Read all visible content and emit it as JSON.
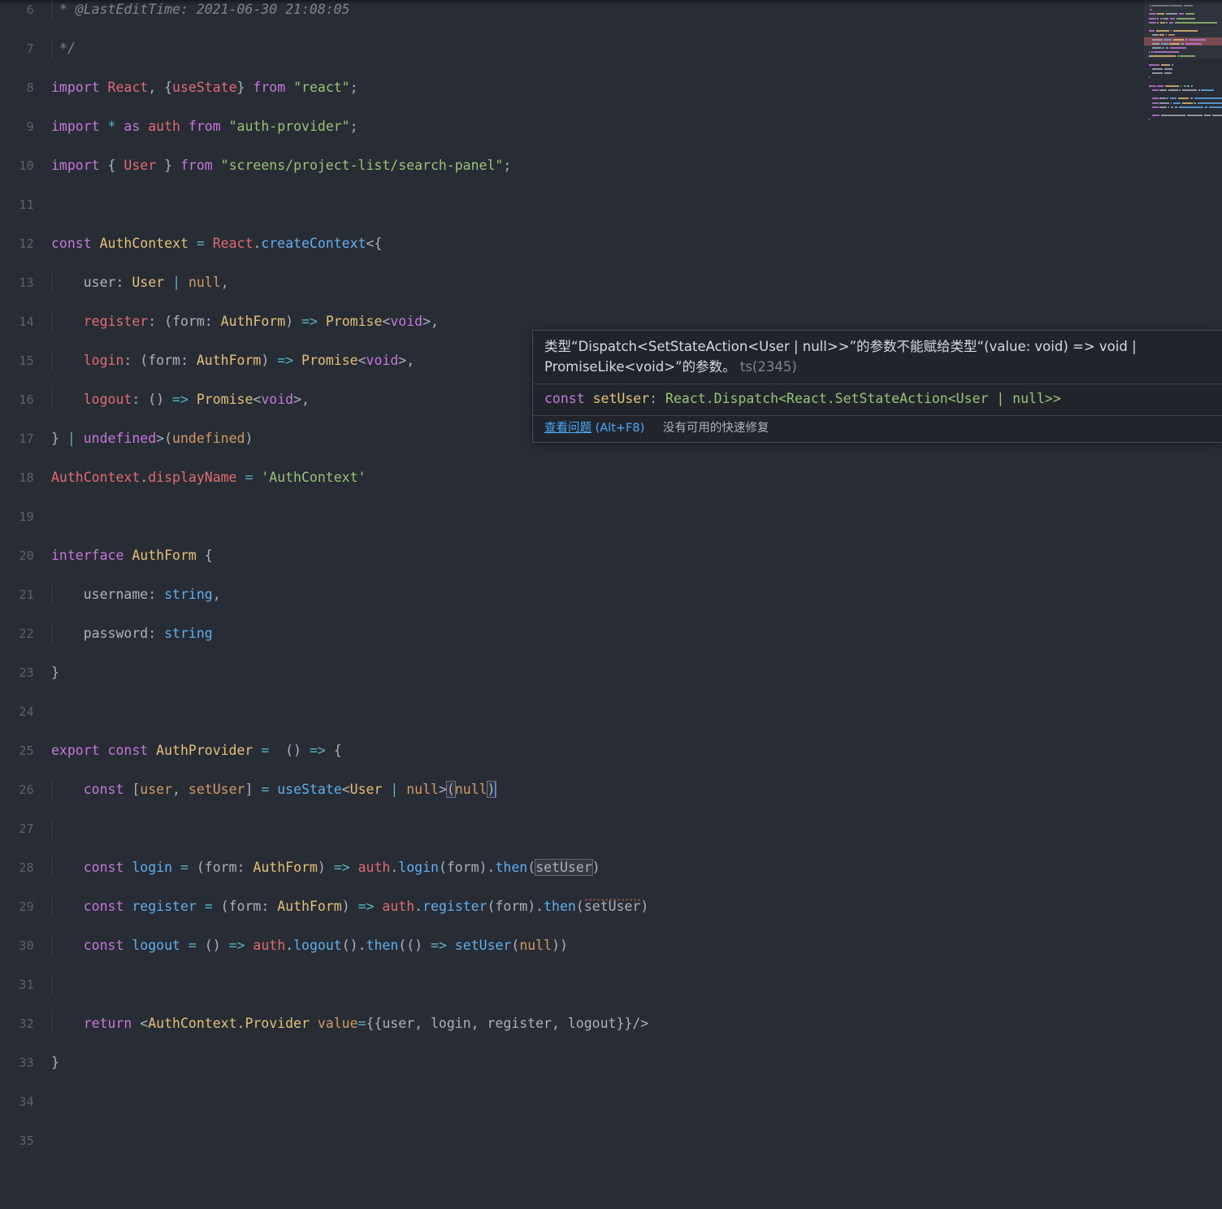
{
  "editor": {
    "theme_bg": "#282c34",
    "gutter_color": "#5c6370",
    "first_visible_line": 6,
    "last_visible_line": 35,
    "lines": [
      {
        "n": "6",
        "text": " * @LastEditTime: 2021-06-30 21:08:05"
      },
      {
        "n": "7",
        "text": " */"
      },
      {
        "n": "8",
        "text": "import React, {useState} from \"react\";"
      },
      {
        "n": "9",
        "text": "import * as auth from \"auth-provider\";"
      },
      {
        "n": "10",
        "text": "import { User } from \"screens/project-list/search-panel\";"
      },
      {
        "n": "11",
        "text": ""
      },
      {
        "n": "12",
        "text": "const AuthContext = React.createContext<{"
      },
      {
        "n": "13",
        "text": "    user: User | null,"
      },
      {
        "n": "14",
        "text": "    register: (form: AuthForm) => Promise<void>,"
      },
      {
        "n": "15",
        "text": "    login: (form: AuthForm) => Promise<void>,"
      },
      {
        "n": "16",
        "text": "    logout: () => Promise<void>,"
      },
      {
        "n": "17",
        "text": "} | undefined>(undefined)"
      },
      {
        "n": "18",
        "text": "AuthContext.displayName = 'AuthContext'"
      },
      {
        "n": "19",
        "text": ""
      },
      {
        "n": "20",
        "text": "interface AuthForm {"
      },
      {
        "n": "21",
        "text": "    username: string,"
      },
      {
        "n": "22",
        "text": "    password: string"
      },
      {
        "n": "23",
        "text": "}"
      },
      {
        "n": "24",
        "text": ""
      },
      {
        "n": "25",
        "text": "export const AuthProvider =  () => {"
      },
      {
        "n": "26",
        "text": "    const [user, setUser] = useState<User | null>(null)"
      },
      {
        "n": "27",
        "text": ""
      },
      {
        "n": "28",
        "text": "    const login = (form: AuthForm) => auth.login(form).then(setUser)"
      },
      {
        "n": "29",
        "text": "    const register = (form: AuthForm) => auth.register(form).then(setUser)"
      },
      {
        "n": "30",
        "text": "    const logout = () => auth.logout().then(() => setUser(null))"
      },
      {
        "n": "31",
        "text": ""
      },
      {
        "n": "32",
        "text": "    return <AuthContext.Provider value={{user, login, register, logout}}/>"
      },
      {
        "n": "33",
        "text": "}"
      },
      {
        "n": "34",
        "text": ""
      },
      {
        "n": "35",
        "text": ""
      }
    ]
  },
  "tooltip": {
    "message_part1": "类型“Dispatch<SetStateAction<User | null>>”的参数不能赋给类型“(value: void) => void | PromiseLike<void>”的参数。",
    "error_code": "ts(2345)",
    "signature": {
      "kw_const": "const",
      "name": "setUser",
      "colon": ": ",
      "type_text": "React.Dispatch<React.SetStateAction<User | null>>"
    },
    "view_problem_label": "查看问题",
    "view_problem_shortcut": "(Alt+F8)",
    "no_quickfix_label": "没有可用的快速修复"
  },
  "minimap": {
    "present": true,
    "error_band_visible": true
  },
  "colors": {
    "keyword": "#c678dd",
    "variable": "#e06c75",
    "function": "#61afef",
    "type": "#e5c07b",
    "string": "#98c379",
    "number": "#d19a66",
    "operator": "#56b6c2",
    "comment": "#7f848e",
    "foreground": "#abb2bf",
    "error": "#e06c75",
    "link": "#4daafc",
    "cursor": "#528bff"
  }
}
